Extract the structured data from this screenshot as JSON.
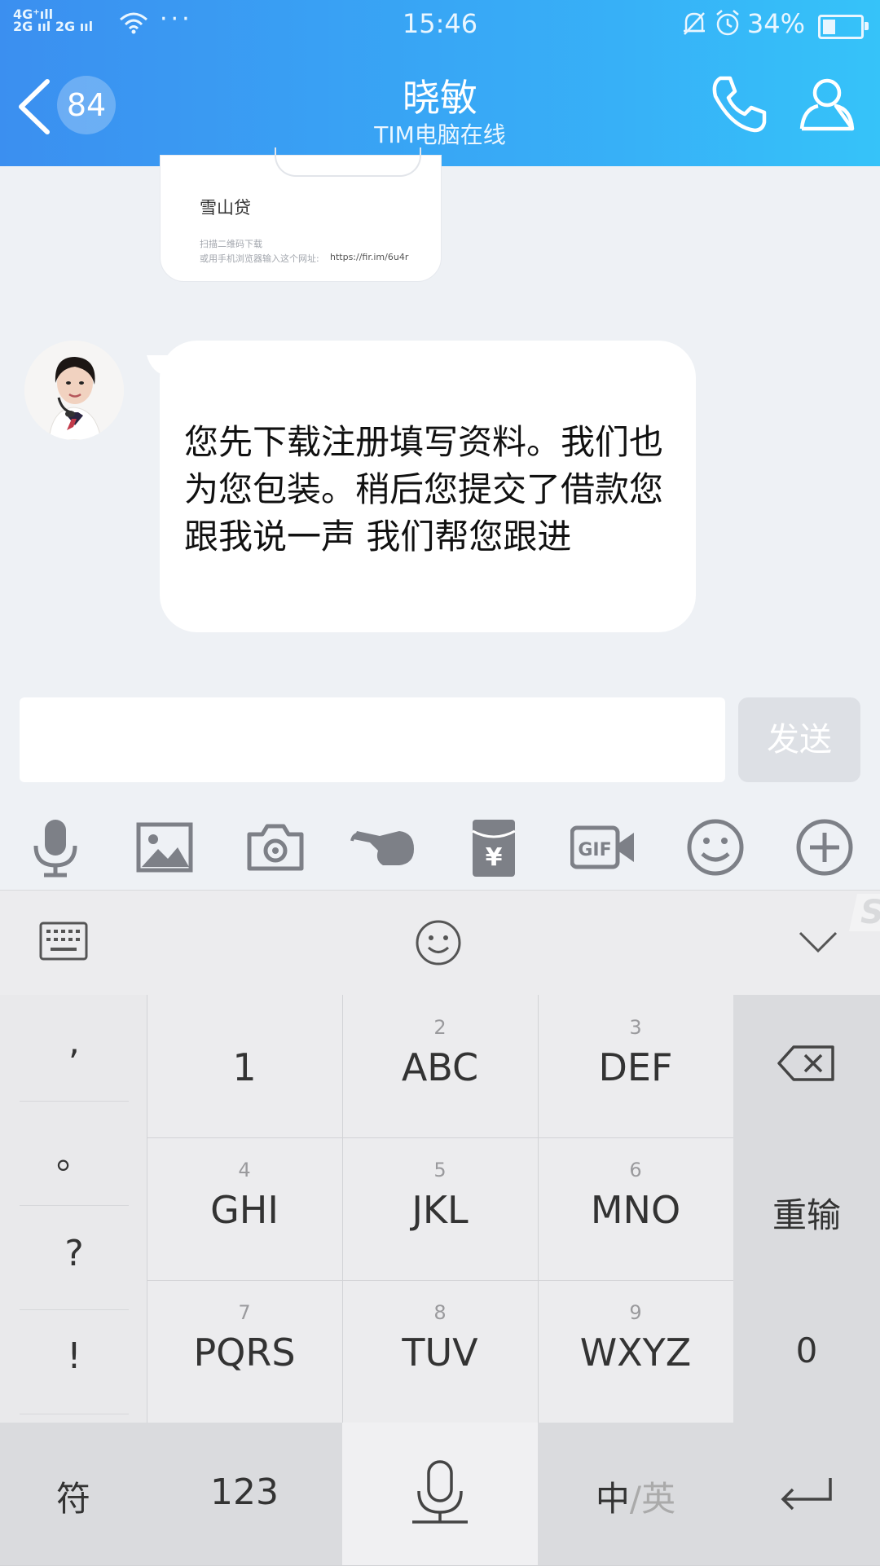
{
  "status_bar": {
    "network_line1": "4G⁺ıll",
    "network_line2": "2G ııl 2G ııl",
    "time": "15:46",
    "battery_pct_text": "34%",
    "battery_level": 0.34
  },
  "header": {
    "unread_count": "84",
    "title": "晓敏",
    "subtitle": "TIM电脑在线"
  },
  "card_message": {
    "app_name": "雪山贷",
    "hint_line1": "扫描二维码下载",
    "hint_line2": "或用手机浏览器输入这个网址:",
    "url": "https://fir.im/6u4r"
  },
  "message": {
    "text": "您先下载注册填写资料。我们也为您包装。稍后您提交了借款您跟我说一声 我们帮您跟进"
  },
  "input": {
    "value": "",
    "send_label": "发送"
  },
  "toolbar": {
    "icons": [
      "microphone-icon",
      "image-icon",
      "camera-icon",
      "poke-hand-icon",
      "red-packet-icon",
      "gif-icon",
      "emoji-icon",
      "plus-icon"
    ]
  },
  "keyboard": {
    "punctuation": [
      ",",
      "。",
      "?",
      "!"
    ],
    "keys": [
      {
        "num": "",
        "letters": "1"
      },
      {
        "num": "2",
        "letters": "ABC"
      },
      {
        "num": "3",
        "letters": "DEF"
      },
      {
        "num": "4",
        "letters": "GHI"
      },
      {
        "num": "5",
        "letters": "JKL"
      },
      {
        "num": "6",
        "letters": "MNO"
      },
      {
        "num": "7",
        "letters": "PQRS"
      },
      {
        "num": "8",
        "letters": "TUV"
      },
      {
        "num": "9",
        "letters": "WXYZ"
      }
    ],
    "reenter_label": "重输",
    "zero_label": "0",
    "symbol_label": "符",
    "num_switch_label": "123",
    "lang_zh": "中",
    "lang_sep": "/",
    "lang_en": "英"
  },
  "colors": {
    "header_start": "#3b8ff0",
    "header_end": "#36c3f9",
    "chat_bg": "#eef1f5",
    "bubble": "#ffffff",
    "toolbar_icon": "#7d8087"
  }
}
